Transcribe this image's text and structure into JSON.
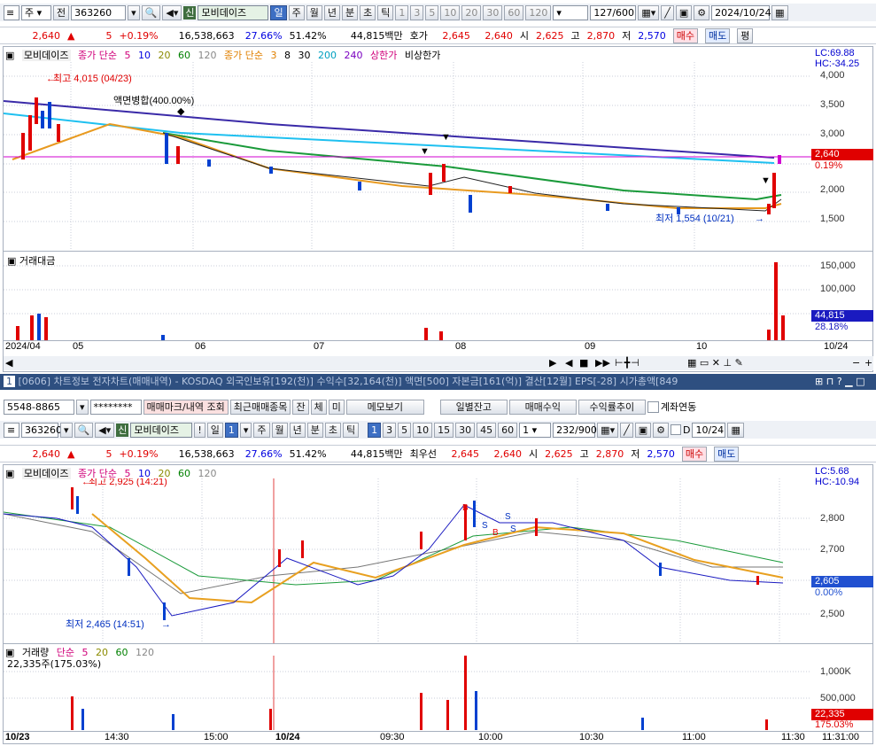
{
  "top": {
    "market": "주",
    "period_btn": "전",
    "code": "363260",
    "tag": "신",
    "name": "모비데이즈",
    "period_tabs": [
      "일",
      "주",
      "월",
      "년",
      "분",
      "초",
      "틱"
    ],
    "minute_tabs": [
      "1",
      "3",
      "5",
      "10",
      "20",
      "30",
      "60",
      "120"
    ],
    "count": "127/600",
    "date": "2024/10/24"
  },
  "quote": {
    "price": "2,640",
    "change": "5",
    "rate": "+0.19%",
    "volume": "16,538,663",
    "pct1": "27.66%",
    "pct2": "51.42%",
    "amount": "44,815백만",
    "label_hoga": "호가",
    "ask": "2,645",
    "bid": "2,640",
    "label_open": "시",
    "open": "2,625",
    "label_high": "고",
    "high": "2,870",
    "label_low": "저",
    "low": "2,570",
    "buy": "매수",
    "sell": "매도",
    "eval": "평"
  },
  "daily": {
    "legend": {
      "name": "모비데이즈",
      "ma1_label": "종가 단순",
      "ma1_periods": [
        "5",
        "10",
        "20",
        "60",
        "120"
      ],
      "ma2_label": "종가 단순",
      "ma2_periods": [
        "3",
        "8",
        "30",
        "200",
        "240"
      ],
      "upper": "상한가",
      "nonupper": "비상한가"
    },
    "lc": "LC:69.88",
    "hc": "HC:-34.25",
    "price_tag": "2,640",
    "pct_tag": "0.19%",
    "y_ticks": [
      "4,000",
      "3,500",
      "3,000",
      "2,500",
      "2,000",
      "1,500"
    ],
    "annot_high": "최고 4,015 (04/23)",
    "annot_split": "액면병합(400.00%)",
    "annot_low": "최저 1,554 (10/21)",
    "vol_title": "거래대금",
    "vol_ticks": [
      "150,000",
      "100,000"
    ],
    "vol_tag": "44,815",
    "vol_pct": "28.18%",
    "x_labels": [
      "2024/04",
      "05",
      "06",
      "07",
      "08",
      "09",
      "10"
    ],
    "x_right": "10/24"
  },
  "status": {
    "num": "1",
    "text": "[0606] 차트정보 전자차트(매매내역) - KOSDAQ 외국인보유[192(천)] 수익수[32,164(천)] 액면[500] 자본금[161(억)] 결산[12월] EPS[-28] 시가총액[849"
  },
  "account": {
    "acct": "5548-8865",
    "pw": "********",
    "btns": [
      "매매마크/내역 조회",
      "최근매매종목",
      "잔",
      "체",
      "미",
      "메모보기"
    ],
    "btns2": [
      "일별잔고",
      "매매수익",
      "수익률추이"
    ],
    "check": "계좌연동"
  },
  "intra_top": {
    "code": "363260",
    "tag": "신",
    "name": "모비데이즈",
    "bang": "!",
    "p1": "일",
    "p1v": "1",
    "tabs": [
      "주",
      "월",
      "년",
      "분",
      "초",
      "틱"
    ],
    "mins": [
      "1",
      "3",
      "5",
      "10",
      "15",
      "30",
      "45",
      "60"
    ],
    "sel": "1",
    "count": "232/900",
    "d": "D",
    "date": "10/24"
  },
  "quote2": {
    "price": "2,640",
    "change": "5",
    "rate": "+0.19%",
    "volume": "16,538,663",
    "pct1": "27.66%",
    "pct2": "51.42%",
    "amount": "44,815백만",
    "label": "최우선",
    "ask": "2,645",
    "bid": "2,640",
    "label_open": "시",
    "open": "2,625",
    "label_high": "고",
    "high": "2,870",
    "label_low": "저",
    "low": "2,570",
    "buy": "매수",
    "sell": "매도"
  },
  "intra": {
    "legend": {
      "name": "모비데이즈",
      "ma_label": "종가 단순",
      "periods": [
        "5",
        "10",
        "20",
        "60",
        "120"
      ]
    },
    "lc": "LC:5.68",
    "hc": "HC:-10.94",
    "y_ticks": [
      "2,800",
      "2,700",
      "2,500"
    ],
    "price_tag": "2,605",
    "pct_tag": "0.00%",
    "annot_high": "최고 2,925 (14:21)",
    "annot_low": "최저 2,465 (14:51)",
    "vol_legend": {
      "name": "거래량",
      "ma_label": "단순",
      "periods": [
        "5",
        "20",
        "60",
        "120"
      ]
    },
    "vol_sub": "22,335주(175.03%)",
    "vol_ticks": [
      "1,000K",
      "500,000"
    ],
    "vol_tag": "22,335",
    "vol_pct": "175.03%",
    "x_labels": [
      "10/23",
      "14:30",
      "15:00",
      "10/24",
      "09:30",
      "10:00",
      "10:30",
      "11:00",
      "11:30"
    ],
    "x_right": "11:31:00",
    "marks": [
      "B",
      "S",
      "S",
      "S",
      "B"
    ]
  },
  "colors": {
    "up": "#e00000",
    "down": "#0040d0",
    "accent": "#3d6fc4"
  }
}
